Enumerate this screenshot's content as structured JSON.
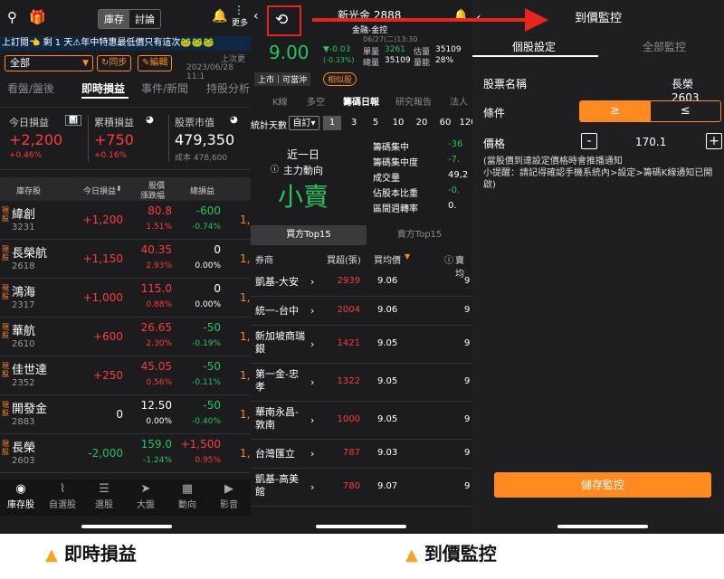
{
  "panel1": {
    "seg_tabs": [
      "庫存",
      "討論"
    ],
    "more_label": "更多",
    "marquee": "上訂閱👈  剩 1 天⚠年中特惠最低價只有這次🐸🐸🐸",
    "account_select": "全部",
    "sync_button": "同步",
    "edit_button": "編輯",
    "updated": "2023/06/28 11:1",
    "last_update_label": "上次更",
    "tabs": [
      "看盤/盤後",
      "即時損益",
      "事件/新聞",
      "持股分析"
    ],
    "summary": {
      "today_label": "今日損益",
      "today_value": "+2,200",
      "today_pct": "+0.46%",
      "acc_label": "累積損益",
      "acc_value": "+750",
      "acc_pct": "+0.16%",
      "mv_label": "股票市值",
      "mv_value": "479,350",
      "cost": "成本 478,600"
    },
    "table_header": {
      "stock": "庫存股",
      "today": "今日損益",
      "price": "股價",
      "price2": "漲跌幅",
      "total": "總損益"
    },
    "rows": [
      {
        "tag": "現股",
        "name": "緯創",
        "code": "3231",
        "pnl": "+1,200",
        "price": "80.8",
        "pct": "1.51%",
        "chg": "-600",
        "chgp": "-0.74%",
        "pnl_color": "red",
        "price_color": "red",
        "chg_color": "green"
      },
      {
        "tag": "現股",
        "name": "長榮航",
        "code": "2618",
        "pnl": "+1,150",
        "price": "40.35",
        "pct": "2.93%",
        "chg": "0",
        "chgp": "0.00%",
        "pnl_color": "red",
        "price_color": "red",
        "chg_color": "white"
      },
      {
        "tag": "現股",
        "name": "鴻海",
        "code": "2317",
        "pnl": "+1,000",
        "price": "115.0",
        "pct": "0.88%",
        "chg": "0",
        "chgp": "0.00%",
        "pnl_color": "red",
        "price_color": "red",
        "chg_color": "white"
      },
      {
        "tag": "現股",
        "name": "華航",
        "code": "2610",
        "pnl": "+600",
        "price": "26.65",
        "pct": "2.30%",
        "chg": "-50",
        "chgp": "-0.19%",
        "pnl_color": "red",
        "price_color": "red",
        "chg_color": "green"
      },
      {
        "tag": "現股",
        "name": "佳世達",
        "code": "2352",
        "pnl": "+250",
        "price": "45.05",
        "pct": "0.56%",
        "chg": "-50",
        "chgp": "-0.11%",
        "pnl_color": "red",
        "price_color": "red",
        "chg_color": "green"
      },
      {
        "tag": "現股",
        "name": "開發金",
        "code": "2883",
        "pnl": "0",
        "price": "12.50",
        "pct": "0.00%",
        "chg": "-50",
        "chgp": "-0.40%",
        "pnl_color": "white",
        "price_color": "white",
        "chg_color": "green"
      },
      {
        "tag": "現股",
        "name": "長榮",
        "code": "2603",
        "pnl": "-2,000",
        "price": "159.0",
        "pct": "-1.24%",
        "chg": "+1,500",
        "chgp": "0.95%",
        "pnl_color": "green",
        "price_color": "green",
        "chg_color": "red"
      }
    ],
    "right_cut": [
      "1,",
      "1,",
      "1,",
      "1,",
      "1,",
      "1,",
      "1,"
    ],
    "nav": [
      "庫存股",
      "自選股",
      "選股",
      "大盤",
      "動向",
      "影音"
    ]
  },
  "panel2": {
    "title": "新光金 2888",
    "subtitle": "金融-金控",
    "time": "06/27(二)13:30",
    "price": "9.00",
    "change": "▼-0.03",
    "change_pct": "(-0.33%)",
    "single_label": "單量",
    "single_value": "3261",
    "total_label": "總量",
    "total_value": "35109",
    "est_label": "估量",
    "est_value": "35109",
    "est_pct_label": "量能",
    "est_pct": "28%",
    "listed": "上市｜可當沖",
    "similar": "相似股",
    "tabs": [
      "K線",
      "多空",
      "籌碼日報",
      "研究報告",
      "法人"
    ],
    "days_label": "統計天數",
    "custom_label": "自訂",
    "days": [
      "1",
      "3",
      "5",
      "10",
      "20",
      "60",
      "120"
    ],
    "period": "近一日",
    "force_label": "主力動向",
    "verdict": "小賣",
    "stats": [
      {
        "label": "籌碼集中",
        "value": "-36"
      },
      {
        "label": "籌碼集中度",
        "value": "-7."
      },
      {
        "label": "成交量",
        "value": "49,2"
      },
      {
        "label": "佔股本比重",
        "value": "-0."
      },
      {
        "label": "區間週轉率",
        "value": "0."
      }
    ],
    "tab15": [
      "買方Top15",
      "賣方Top15"
    ],
    "thead": {
      "broker": "券商",
      "buy": "買超(張)",
      "avg": "買均價",
      "sell": "賣均"
    },
    "brokers": [
      {
        "name": "凱基-大安",
        "buy": "2939",
        "avg": "9.06",
        "cut": "9"
      },
      {
        "name": "統一-台中",
        "buy": "2004",
        "avg": "9.06",
        "cut": "9"
      },
      {
        "name": "新加坡商瑞銀",
        "buy": "1421",
        "avg": "9.05",
        "cut": "9"
      },
      {
        "name": "第一金-忠孝",
        "buy": "1322",
        "avg": "9.05",
        "cut": "9"
      },
      {
        "name": "華南永昌-敦南",
        "buy": "1000",
        "avg": "9.05",
        "cut": "9"
      },
      {
        "name": "台灣匯立",
        "buy": "787",
        "avg": "9.03",
        "cut": "9"
      },
      {
        "name": "凱基-高美館",
        "buy": "780",
        "avg": "9.07",
        "cut": "9"
      }
    ]
  },
  "panel3": {
    "title": "到價監控",
    "tabs": [
      "個股設定",
      "全部監控"
    ],
    "stock_label": "股票名稱",
    "stock_value": "長榮 2603",
    "cond_label": "條件",
    "cond_options": [
      "≥",
      "≤"
    ],
    "price_label": "價格",
    "price_value": "170.1",
    "minus": "-",
    "plus": "+",
    "note": "(當股價到達設定價格時會推播通知\n小提醒：請記得確認手機系統內>設定>籌碼K線通知已開啟)",
    "save_button": "儲存監控"
  },
  "captions": [
    "即時損益",
    "到價監控"
  ],
  "accent_color": "#ff8a1f",
  "highlight_color": "#e8251c"
}
